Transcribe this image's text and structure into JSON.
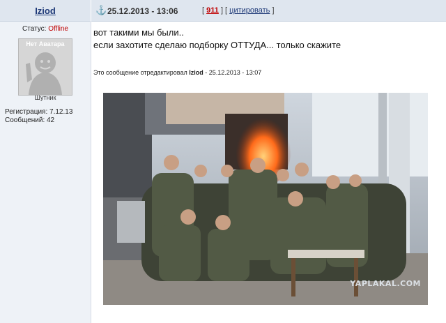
{
  "post": {
    "username": "Iziod",
    "date": "25.12.2013 - 13:06",
    "rating_open": "[",
    "rating_value": "911",
    "rating_sep": "] [",
    "quote_label": "цитировать",
    "rating_close": "]",
    "anchor_icon": "anchor-icon",
    "body_line1": "вот такими мы были..",
    "body_line2": "если захотите сделаю подборку ОТТУДА... только скажите",
    "edit_prefix": "Это сообщение отредактировал",
    "edit_user": "Iziod",
    "edit_suffix": "- 25.12.2013 - 13:07"
  },
  "user": {
    "status_label": "Статус:",
    "status_value": "Offline",
    "avatar_text": "Нет Аватара",
    "rank": "Шутник",
    "registration": "Регистрация: 7.12.13",
    "messages": "Сообщений: 42"
  },
  "image": {
    "watermark": "YAPLAKAL.COM"
  },
  "colors": {
    "header_bg": "#dfe6ef",
    "sidebar_bg": "#eef2f7",
    "link": "#1f3a78",
    "accent_red": "#c00000"
  }
}
